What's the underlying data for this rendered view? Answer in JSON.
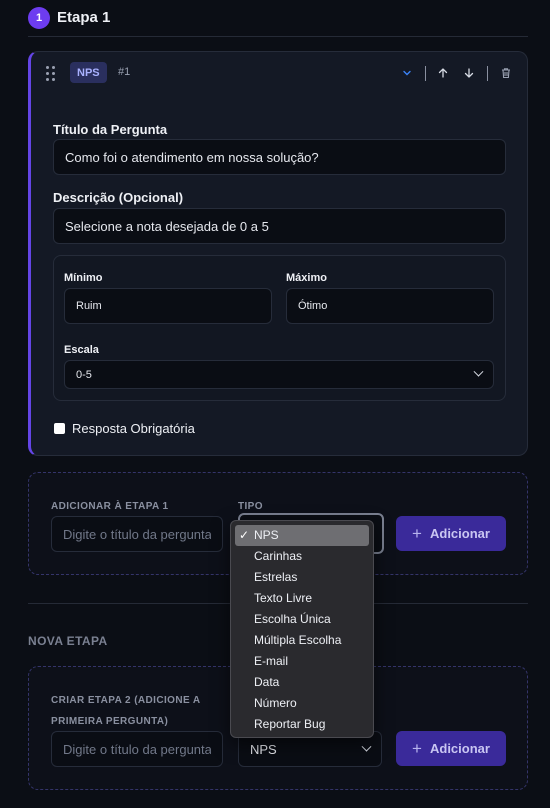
{
  "step": {
    "number": "1",
    "title": "Etapa 1"
  },
  "question": {
    "type_badge": "NPS",
    "index": "#1",
    "title_label": "Título da Pergunta",
    "title_value": "Como foi o atendimento em nossa solução?",
    "desc_label": "Descrição (Opcional)",
    "desc_value": "Selecione a nota desejada de 0 a 5",
    "min_label": "Mínimo",
    "min_value": "Ruim",
    "max_label": "Máximo",
    "max_value": "Ótimo",
    "scale_label": "Escala",
    "scale_value": "0-5",
    "required_label": "Resposta Obrigatória",
    "required_checked": false
  },
  "add_question": {
    "label": "ADICIONAR À ETAPA 1",
    "type_label": "TIPO",
    "placeholder": "Digite o título da pergunta",
    "button": "Adicionar"
  },
  "type_dropdown": {
    "selected": "NPS",
    "options": [
      "NPS",
      "Carinhas",
      "Estrelas",
      "Texto Livre",
      "Escolha Única",
      "Múltipla Escolha",
      "E-mail",
      "Data",
      "Número",
      "Reportar Bug"
    ]
  },
  "new_step": {
    "section_label": "NOVA ETAPA",
    "label_line1": "CRIAR ETAPA 2 (ADICIONE A",
    "label_line2": "PRIMEIRA PERGUNTA)",
    "placeholder": "Digite o título da pergunta",
    "type_value": "NPS",
    "button": "Adicionar"
  },
  "colors": {
    "accent": "#6d3cf0",
    "active_arrow": "#3b82f6",
    "button": "#3a2a9a"
  }
}
